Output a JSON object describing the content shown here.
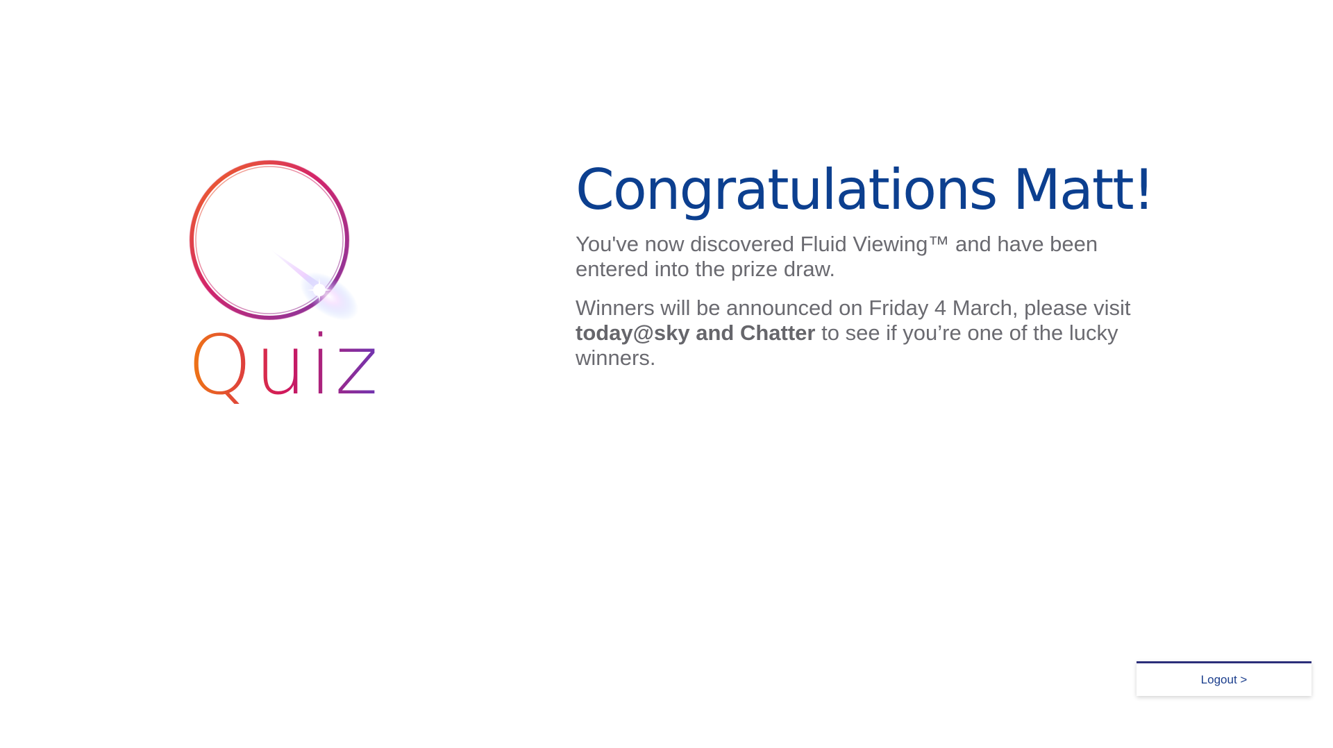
{
  "logo": {
    "word": "Quiz",
    "icon": "quiz-q-ring-icon",
    "colors": {
      "ring_start": "#f26b1e",
      "ring_mid": "#d3246a",
      "ring_end": "#7b3aa8",
      "flare": "#8fb7ff"
    }
  },
  "message": {
    "title": "Congratulations Matt!",
    "para1": "You've now discovered Fluid Viewing™ and have been entered into the prize draw.",
    "para2_before": "Winners will be announced on Friday 4 March, please visit",
    "para2_bold": "today@sky and Chatter",
    "para2_after": "to see if you’re one of the lucky winners."
  },
  "logout": {
    "label": "Logout >"
  },
  "colors": {
    "title": "#0c3f8f",
    "body_text": "#6a6a70",
    "logout_accent": "#2b2e7a"
  }
}
